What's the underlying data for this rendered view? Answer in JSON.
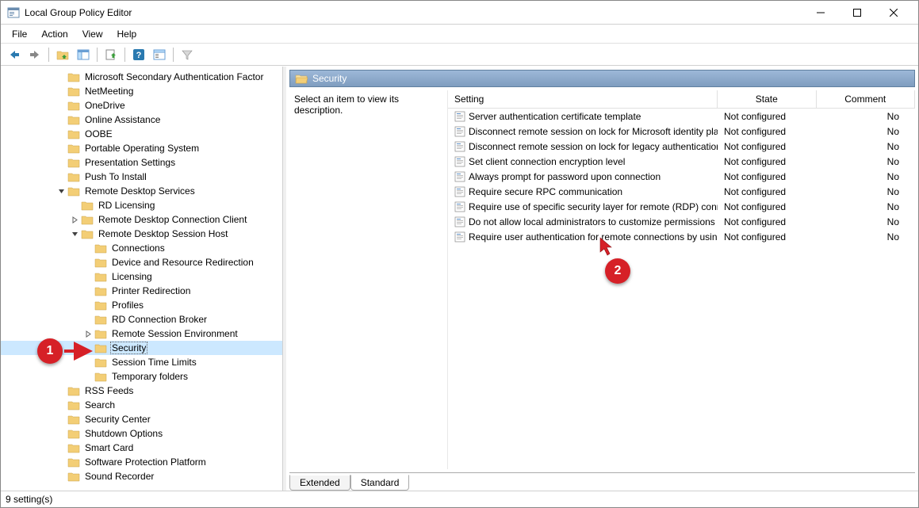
{
  "window": {
    "title": "Local Group Policy Editor"
  },
  "menu": {
    "file": "File",
    "action": "Action",
    "view": "View",
    "help": "Help"
  },
  "content": {
    "header_label": "Security",
    "description": "Select an item to view its description.",
    "columns": {
      "setting": "Setting",
      "state": "State",
      "comment": "Comment"
    },
    "settings": [
      {
        "name": "Server authentication certificate template",
        "state": "Not configured",
        "comment": "No"
      },
      {
        "name": "Disconnect remote session on lock for Microsoft identity pla...",
        "state": "Not configured",
        "comment": "No"
      },
      {
        "name": "Disconnect remote session on lock for legacy authentication",
        "state": "Not configured",
        "comment": "No"
      },
      {
        "name": "Set client connection encryption level",
        "state": "Not configured",
        "comment": "No"
      },
      {
        "name": "Always prompt for password upon connection",
        "state": "Not configured",
        "comment": "No"
      },
      {
        "name": "Require secure RPC communication",
        "state": "Not configured",
        "comment": "No"
      },
      {
        "name": "Require use of specific security layer for remote (RDP) conn...",
        "state": "Not configured",
        "comment": "No"
      },
      {
        "name": "Do not allow local administrators to customize permissions",
        "state": "Not configured",
        "comment": "No"
      },
      {
        "name": "Require user authentication for remote connections by usin...",
        "state": "Not configured",
        "comment": "No"
      }
    ],
    "tabs": {
      "extended": "Extended",
      "standard": "Standard"
    }
  },
  "tree": {
    "items": [
      {
        "indent": 4,
        "label": "Microsoft Secondary Authentication Factor",
        "twisty": "none"
      },
      {
        "indent": 4,
        "label": "NetMeeting",
        "twisty": "none"
      },
      {
        "indent": 4,
        "label": "OneDrive",
        "twisty": "none"
      },
      {
        "indent": 4,
        "label": "Online Assistance",
        "twisty": "none"
      },
      {
        "indent": 4,
        "label": "OOBE",
        "twisty": "none"
      },
      {
        "indent": 4,
        "label": "Portable Operating System",
        "twisty": "none"
      },
      {
        "indent": 4,
        "label": "Presentation Settings",
        "twisty": "none"
      },
      {
        "indent": 4,
        "label": "Push To Install",
        "twisty": "none"
      },
      {
        "indent": 4,
        "label": "Remote Desktop Services",
        "twisty": "open"
      },
      {
        "indent": 5,
        "label": "RD Licensing",
        "twisty": "none"
      },
      {
        "indent": 5,
        "label": "Remote Desktop Connection Client",
        "twisty": "closed"
      },
      {
        "indent": 5,
        "label": "Remote Desktop Session Host",
        "twisty": "open"
      },
      {
        "indent": 6,
        "label": "Connections",
        "twisty": "none"
      },
      {
        "indent": 6,
        "label": "Device and Resource Redirection",
        "twisty": "none"
      },
      {
        "indent": 6,
        "label": "Licensing",
        "twisty": "none"
      },
      {
        "indent": 6,
        "label": "Printer Redirection",
        "twisty": "none"
      },
      {
        "indent": 6,
        "label": "Profiles",
        "twisty": "none"
      },
      {
        "indent": 6,
        "label": "RD Connection Broker",
        "twisty": "none"
      },
      {
        "indent": 6,
        "label": "Remote Session Environment",
        "twisty": "closed"
      },
      {
        "indent": 6,
        "label": "Security",
        "twisty": "none",
        "selected": true
      },
      {
        "indent": 6,
        "label": "Session Time Limits",
        "twisty": "none"
      },
      {
        "indent": 6,
        "label": "Temporary folders",
        "twisty": "none"
      },
      {
        "indent": 4,
        "label": "RSS Feeds",
        "twisty": "none"
      },
      {
        "indent": 4,
        "label": "Search",
        "twisty": "none"
      },
      {
        "indent": 4,
        "label": "Security Center",
        "twisty": "none"
      },
      {
        "indent": 4,
        "label": "Shutdown Options",
        "twisty": "none"
      },
      {
        "indent": 4,
        "label": "Smart Card",
        "twisty": "none"
      },
      {
        "indent": 4,
        "label": "Software Protection Platform",
        "twisty": "none"
      },
      {
        "indent": 4,
        "label": "Sound Recorder",
        "twisty": "none"
      }
    ]
  },
  "statusbar": {
    "text": "9 setting(s)"
  },
  "callouts": {
    "one": "1",
    "two": "2"
  }
}
